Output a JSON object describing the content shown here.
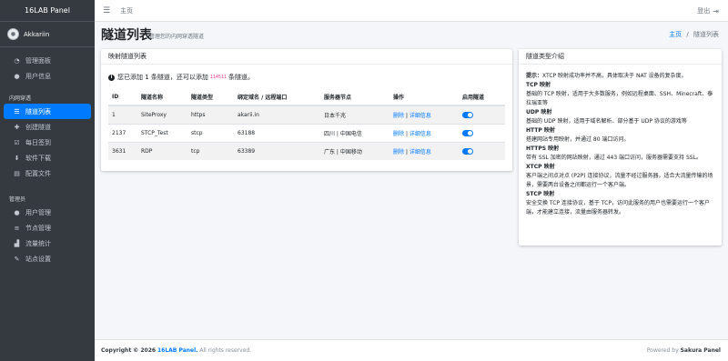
{
  "app": {
    "brand": "16LAB Panel"
  },
  "user": {
    "name": "Akkariin"
  },
  "sidebar": {
    "top_items": [
      {
        "label": "管理面板",
        "icon": "dashboard-icon"
      },
      {
        "label": "用户信息",
        "icon": "user-icon"
      }
    ],
    "section_intranet": "内网穿透",
    "intranet_items": [
      {
        "label": "隧道列表",
        "icon": "list-icon",
        "active": true
      },
      {
        "label": "创建隧道",
        "icon": "plus-icon"
      },
      {
        "label": "每日签到",
        "icon": "check-square-icon"
      },
      {
        "label": "软件下载",
        "icon": "download-icon"
      },
      {
        "label": "配置文件",
        "icon": "file-icon"
      }
    ],
    "section_admin": "管理员",
    "admin_items": [
      {
        "label": "用户管理",
        "icon": "users-icon"
      },
      {
        "label": "节点管理",
        "icon": "server-icon"
      },
      {
        "label": "流量统计",
        "icon": "chart-icon"
      },
      {
        "label": "站点设置",
        "icon": "wrench-icon"
      }
    ]
  },
  "topbar": {
    "home": "主页",
    "logout": "登出"
  },
  "header": {
    "title": "隧道列表",
    "subtitle": "管理您的内网穿透隧道",
    "breadcrumb_home": "主页",
    "breadcrumb_sep": "/",
    "breadcrumb_current": "隧道列表"
  },
  "tunnels": {
    "card_title": "映射隧道列表",
    "notice_prefix": "您已添加 1 条隧道，还可以添加",
    "notice_count": "114511",
    "notice_suffix": "条隧道。",
    "columns": [
      "ID",
      "隧道名称",
      "隧道类型",
      "绑定域名 / 远程端口",
      "服务器节点",
      "操作",
      "启用隧道"
    ],
    "rows": [
      {
        "id": "1",
        "name": "SiteProxy",
        "type": "https",
        "bind": "akarii.in",
        "node": "日本千兆",
        "delete": "删除",
        "sep": "|",
        "detail": "详细信息",
        "enabled": true
      },
      {
        "id": "2137",
        "name": "STCP_Test",
        "type": "stcp",
        "bind": "63188",
        "node": "四川 | 中国电信",
        "delete": "删除",
        "sep": "|",
        "detail": "详细信息",
        "enabled": true
      },
      {
        "id": "3631",
        "name": "RDP",
        "type": "tcp",
        "bind": "63389",
        "node": "广东 | 中国移动",
        "delete": "删除",
        "sep": "|",
        "detail": "详细信息",
        "enabled": true
      }
    ]
  },
  "intro": {
    "card_title": "隧道类型介绍",
    "tip_label": "提示：",
    "tip_text": "XTCP 映射成功率并不高，具体取决于 NAT 设备的复杂度。",
    "sections": [
      {
        "title": "TCP 映射",
        "text": "基础的 TCP 映射，适用于大多数服务，例如远程桌面、SSH、Minecraft、泰拉瑞亚等"
      },
      {
        "title": "UDP 映射",
        "text": "基础的 UDP 映射，适用于域名解析、部分基于 UDP 协议的游戏等"
      },
      {
        "title": "HTTP 映射",
        "text": "搭建网站专用映射，并通过 80 端口访问。"
      },
      {
        "title": "HTTPS 映射",
        "text": "带有 SSL 加密的网站映射，通过 443 端口访问，服务器需要支持 SSL。"
      },
      {
        "title": "XTCP 映射",
        "text": "客户端之间点对点 (P2P) 连接协议，流量不经过服务器，适合大流量传输的场景，需要两台设备之间都运行一个客户端。"
      },
      {
        "title": "STCP 映射",
        "text": "安全交换 TCP 连接协议，基于 TCP，访问此服务的用户也需要运行一个客户端，才能建立连接，流量由服务器转发。"
      }
    ]
  },
  "footer": {
    "copyright_prefix": "Copyright © 2026",
    "brand": "16LAB Panel.",
    "rights": "All rights reserved.",
    "powered_prefix": "Powered by",
    "powered_name": "Sakura Panel"
  },
  "colors": {
    "accent": "#007bff",
    "sidebar_bg": "#343a40",
    "code": "#e83e8c"
  }
}
